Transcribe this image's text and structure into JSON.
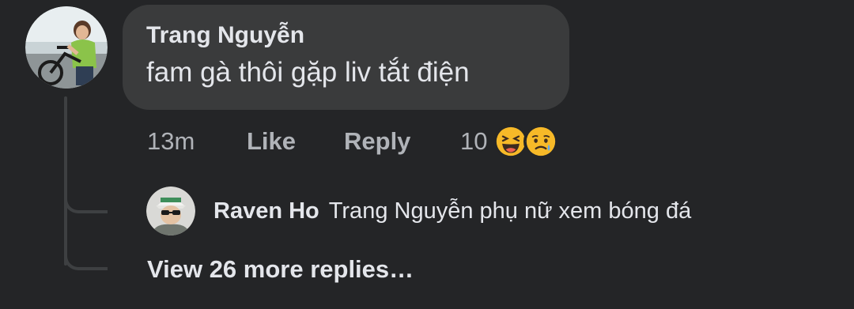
{
  "comment": {
    "author": "Trang Nguyễn",
    "text": "fam gà thôi gặp liv tắt điện",
    "time": "13m",
    "like_label": "Like",
    "reply_label": "Reply",
    "reaction_count": "10",
    "reactions": [
      "laughing-emoji-icon",
      "sad-emoji-icon"
    ]
  },
  "reply": {
    "author": "Raven Ho",
    "text": "Trang Nguyễn phụ nữ xem bóng đá"
  },
  "view_more": "View 26 more replies…",
  "colors": {
    "background": "#242527",
    "bubble": "#3a3b3c",
    "text": "#e4e6eb",
    "secondary_text": "#b0b3b8",
    "thread_line": "#3e4042",
    "emoji_yellow": "#f7b928"
  }
}
